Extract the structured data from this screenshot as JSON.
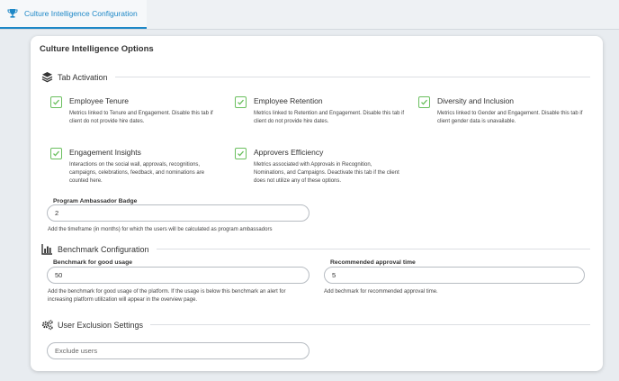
{
  "tab": {
    "label": "Culture Intelligence Configuration",
    "icon": "trophy-icon"
  },
  "card": {
    "title": "Culture Intelligence Options"
  },
  "tab_activation": {
    "label": "Tab Activation",
    "icon": "layers-icon",
    "options": [
      {
        "title": "Employee Tenure",
        "desc": "Metrics linked to Tenure and Engagement. Disable this tab if client do not provide hire dates.",
        "checked": true
      },
      {
        "title": "Employee Retention",
        "desc": "Metrics linked to Retention and Engagement. Disable this tab if client do not provide hire dates.",
        "checked": true
      },
      {
        "title": "Diversity and Inclusion",
        "desc": "Metrics linked to Gender and Engagement. Disable this tab if client gender data is unavailable.",
        "checked": true
      },
      {
        "title": "Engagement Insights",
        "desc": "Interactions on the social wall, approvals, recognitions, campaigns, celebrations, feedback, and nominations are counted here.",
        "checked": true
      },
      {
        "title": "Approvers Efficiency",
        "desc": "Metrics associated with Approvals in Recognition, Nominations, and Campaigns. Deactivate this tab if the client does not utilize any of these options.",
        "checked": true
      }
    ],
    "ambassador": {
      "label": "Program Ambassador Badge",
      "value": "2",
      "help": "Add the timeframe (in months) for which the users will be calculated as program ambassadors"
    }
  },
  "benchmark": {
    "label": "Benchmark Configuration",
    "icon": "bar-chart-icon",
    "good_usage": {
      "label": "Benchmark for good usage",
      "value": "50",
      "help": "Add the benchmark for good usage of the platform. If the usage is below this benchmark an alert for increasing platform utilization will appear in the overview page."
    },
    "approval_time": {
      "label": "Recommended approval time",
      "value": "5",
      "help": "Add bechmark for recommended approval time."
    }
  },
  "exclusion": {
    "label": "User Exclusion Settings",
    "icon": "gears-icon",
    "placeholder": "Exclude users"
  },
  "colors": {
    "accent": "#1e88c7",
    "check": "#6abf5e"
  }
}
